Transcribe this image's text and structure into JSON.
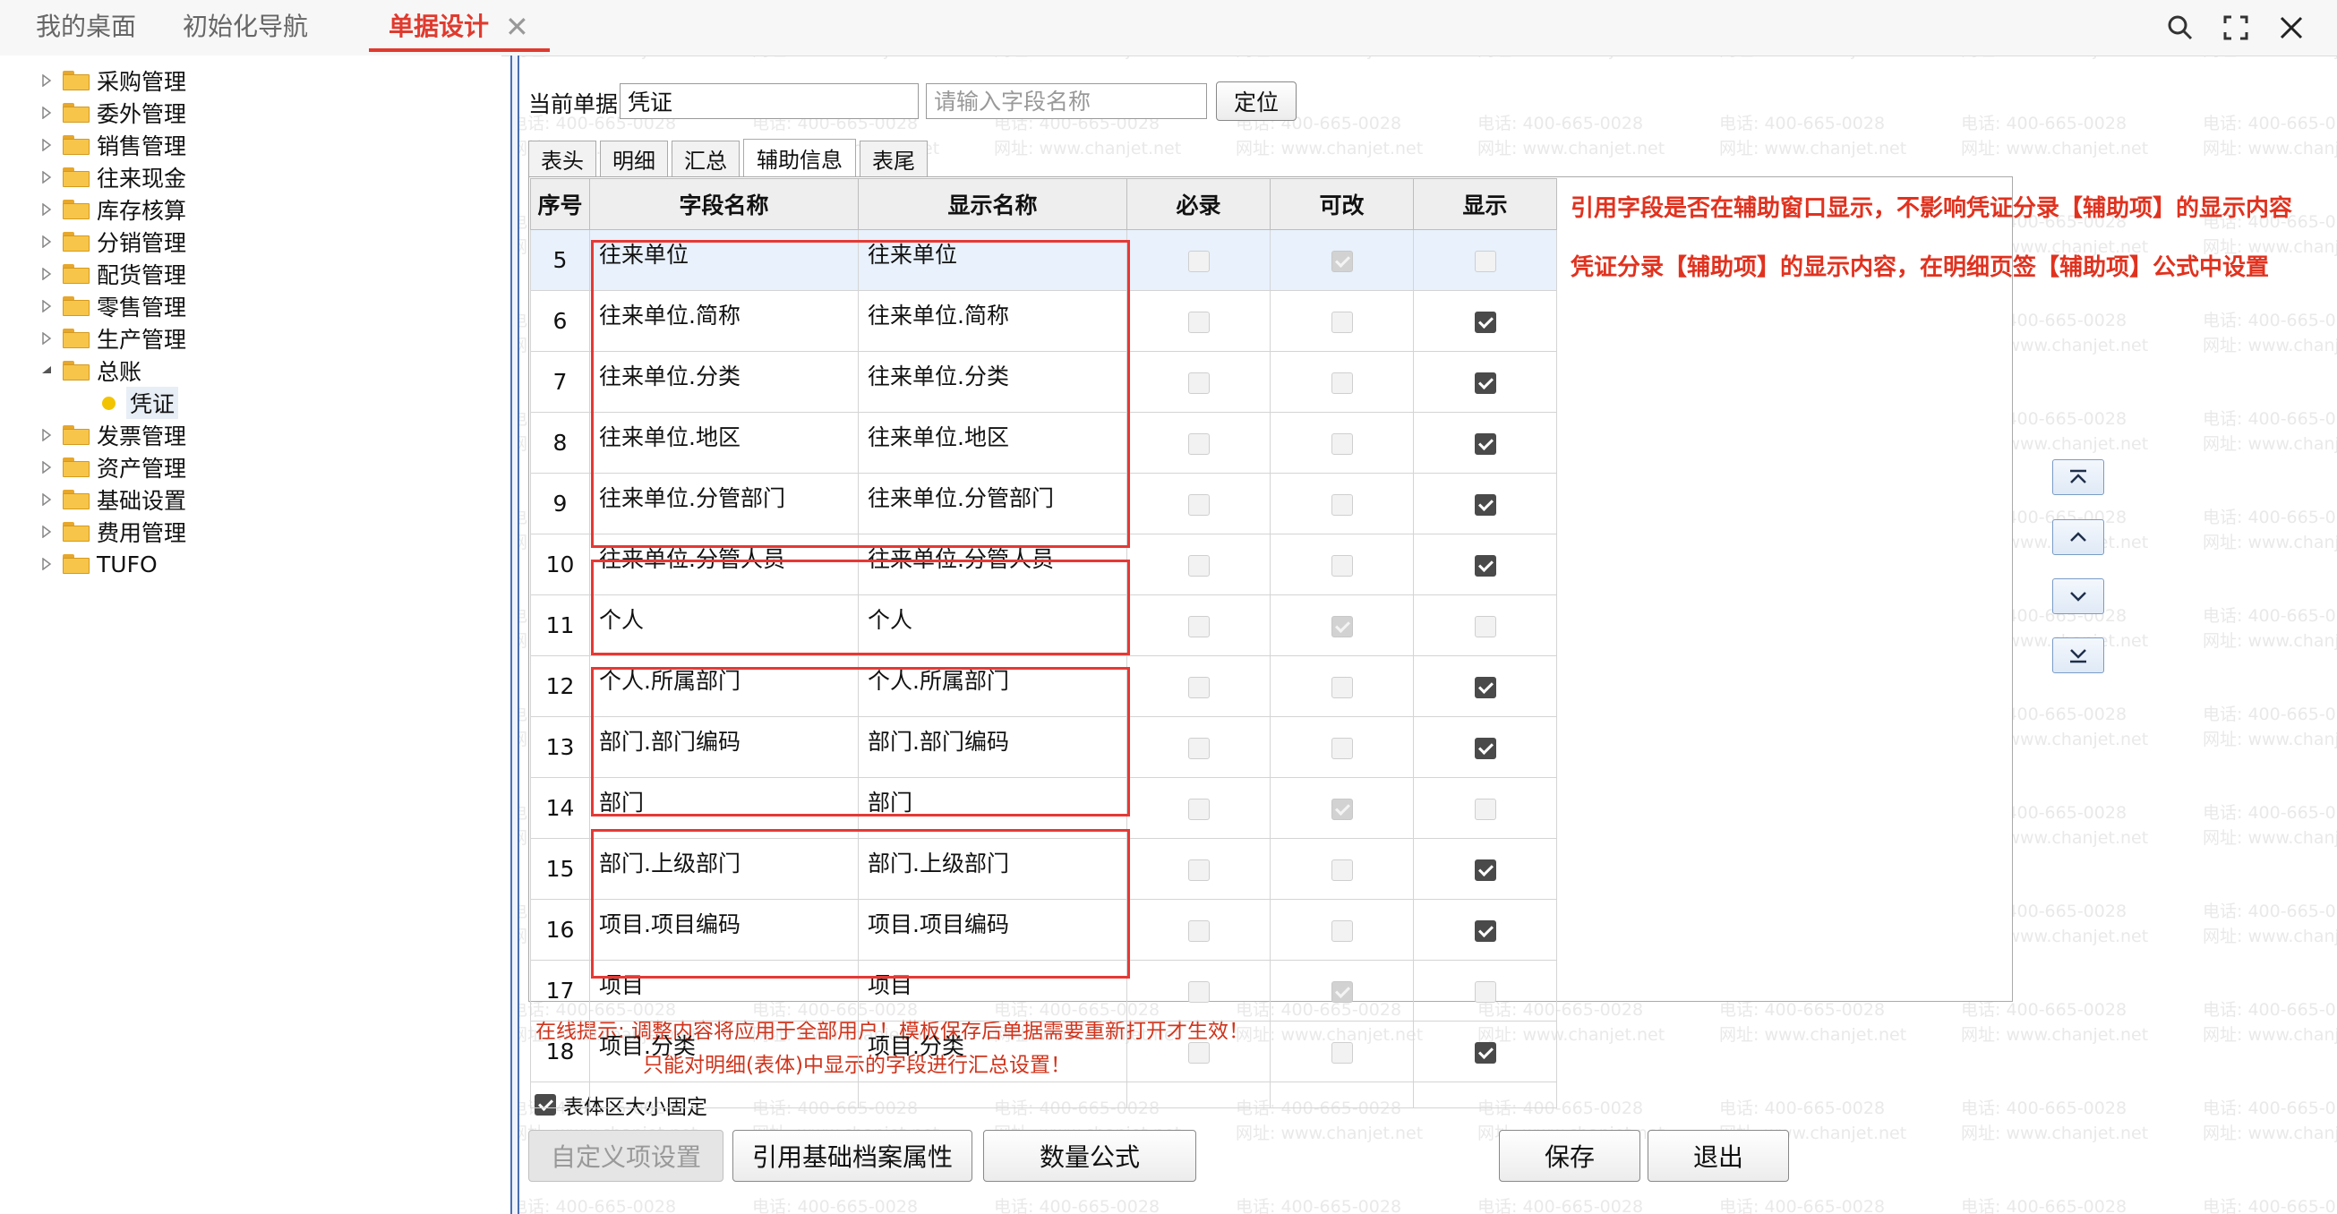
{
  "watermark": {
    "phone": "电话: 400-665-0028",
    "site": "网址: www.chanjet.net"
  },
  "top_tabs": [
    {
      "label": "我的桌面",
      "active": false
    },
    {
      "label": "初始化导航",
      "active": false
    },
    {
      "label": "单据设计",
      "active": true
    }
  ],
  "tree": [
    {
      "label": "采购管理",
      "expanded": false
    },
    {
      "label": "委外管理",
      "expanded": false
    },
    {
      "label": "销售管理",
      "expanded": false
    },
    {
      "label": "往来现金",
      "expanded": false
    },
    {
      "label": "库存核算",
      "expanded": false
    },
    {
      "label": "分销管理",
      "expanded": false
    },
    {
      "label": "配货管理",
      "expanded": false
    },
    {
      "label": "零售管理",
      "expanded": false
    },
    {
      "label": "生产管理",
      "expanded": false
    },
    {
      "label": "总账",
      "expanded": true,
      "children": [
        {
          "label": "凭证",
          "selected": true
        }
      ]
    },
    {
      "label": "发票管理",
      "expanded": false
    },
    {
      "label": "资产管理",
      "expanded": false
    },
    {
      "label": "基础设置",
      "expanded": false
    },
    {
      "label": "费用管理",
      "expanded": false
    },
    {
      "label": "TUFO",
      "expanded": false
    }
  ],
  "toolbar": {
    "current_label": "当前单据",
    "current_value": "凭证",
    "field_placeholder": "请输入字段名称",
    "locate_label": "定位"
  },
  "sub_tabs": [
    {
      "label": "表头",
      "active": false
    },
    {
      "label": "明细",
      "active": false
    },
    {
      "label": "汇总",
      "active": false
    },
    {
      "label": "辅助信息",
      "active": true
    },
    {
      "label": "表尾",
      "active": false
    }
  ],
  "grid": {
    "headers": [
      "序号",
      "字段名称",
      "显示名称",
      "必录",
      "可改",
      "显示"
    ],
    "rows": [
      {
        "no": "5",
        "field": "往来单位",
        "display": "往来单位",
        "required": false,
        "editable": true,
        "editable_disabled": true,
        "visible": false,
        "selected": true
      },
      {
        "no": "6",
        "field": "往来单位.简称",
        "display": "往来单位.简称",
        "required": false,
        "editable": false,
        "editable_disabled": false,
        "visible": true
      },
      {
        "no": "7",
        "field": "往来单位.分类",
        "display": "往来单位.分类",
        "required": false,
        "editable": false,
        "editable_disabled": false,
        "visible": true
      },
      {
        "no": "8",
        "field": "往来单位.地区",
        "display": "往来单位.地区",
        "required": false,
        "editable": false,
        "editable_disabled": false,
        "visible": true
      },
      {
        "no": "9",
        "field": "往来单位.分管部门",
        "display": "往来单位.分管部门",
        "required": false,
        "editable": false,
        "editable_disabled": false,
        "visible": true
      },
      {
        "no": "10",
        "field": "往来单位.分管人员",
        "display": "往来单位.分管人员",
        "required": false,
        "editable": false,
        "editable_disabled": false,
        "visible": true
      },
      {
        "no": "11",
        "field": "个人",
        "display": "个人",
        "required": false,
        "editable": true,
        "editable_disabled": true,
        "visible": false
      },
      {
        "no": "12",
        "field": "个人.所属部门",
        "display": "个人.所属部门",
        "required": false,
        "editable": false,
        "editable_disabled": false,
        "visible": true
      },
      {
        "no": "13",
        "field": "部门.部门编码",
        "display": "部门.部门编码",
        "required": false,
        "editable": false,
        "editable_disabled": false,
        "visible": true
      },
      {
        "no": "14",
        "field": "部门",
        "display": "部门",
        "required": false,
        "editable": true,
        "editable_disabled": true,
        "visible": false
      },
      {
        "no": "15",
        "field": "部门.上级部门",
        "display": "部门.上级部门",
        "required": false,
        "editable": false,
        "editable_disabled": false,
        "visible": true
      },
      {
        "no": "16",
        "field": "项目.项目编码",
        "display": "项目.项目编码",
        "required": false,
        "editable": false,
        "editable_disabled": false,
        "visible": true
      },
      {
        "no": "17",
        "field": "项目",
        "display": "项目",
        "required": false,
        "editable": true,
        "editable_disabled": true,
        "visible": false
      },
      {
        "no": "18",
        "field": "项目.分类",
        "display": "项目.分类",
        "required": false,
        "editable": false,
        "editable_disabled": false,
        "visible": true
      }
    ]
  },
  "annotations": [
    "引用字段是否在辅助窗口显示，不影响凭证分录【辅助项】的显示内容",
    "凭证分录【辅助项】的显示内容，在明细页签【辅助项】公式中设置"
  ],
  "hints": {
    "line1": "在线提示: 调整内容将应用于全部用户！模板保存后单据需要重新打开才生效！",
    "line2": "只能对明细(表体)中显示的字段进行汇总设置！"
  },
  "fixed_size": {
    "label": "表体区大小固定",
    "checked": true
  },
  "buttons": {
    "custom": "自定义项设置",
    "ref_attr": "引用基础档案属性",
    "qty_formula": "数量公式",
    "save": "保存",
    "exit": "退出"
  },
  "colors": {
    "accent": "#e03a2e",
    "annotation": "#e0321f",
    "redbox": "#e53935",
    "selected_row": "#e8f1fc"
  }
}
